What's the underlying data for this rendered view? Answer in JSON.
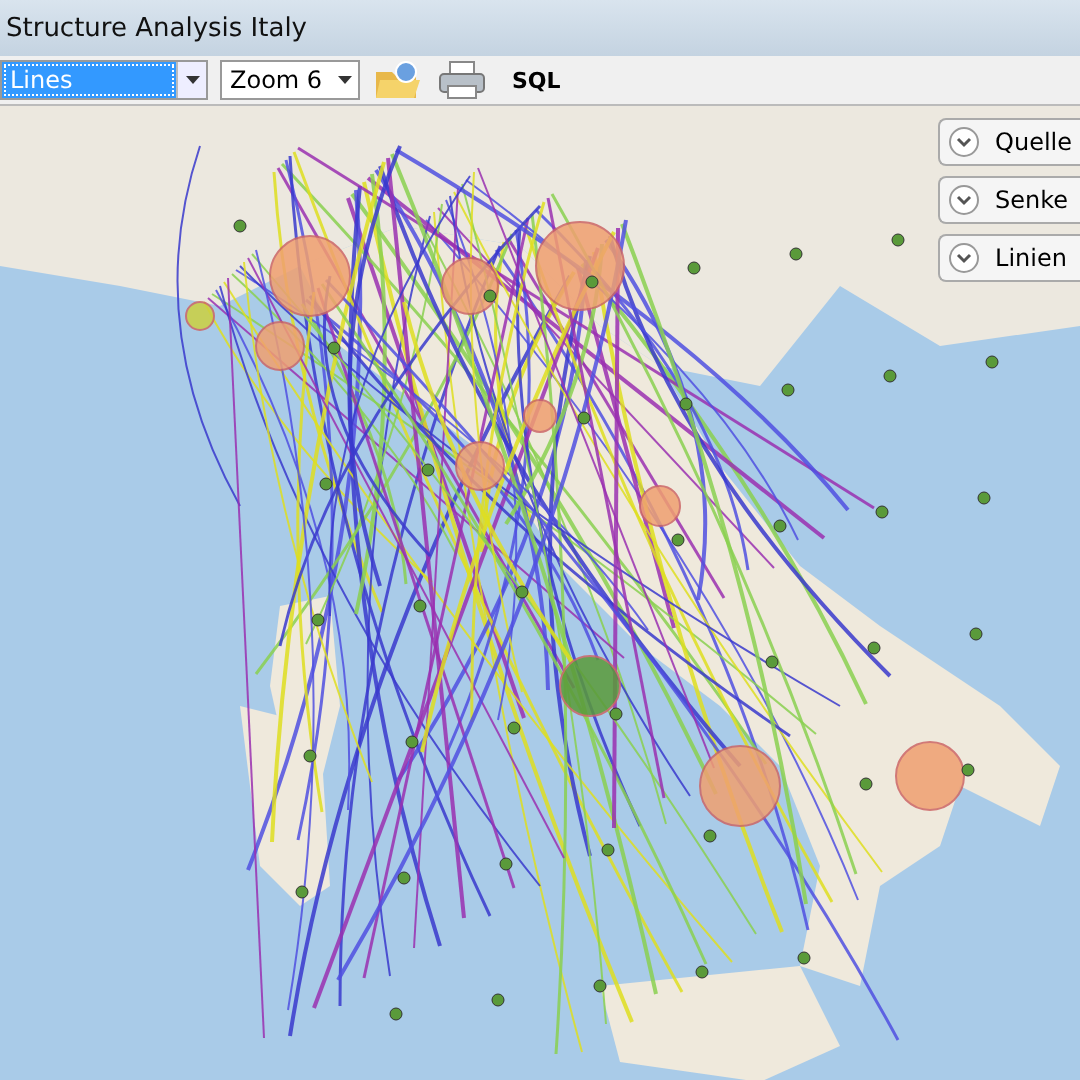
{
  "window": {
    "title": "Structure Analysis Italy"
  },
  "toolbar": {
    "layer_dropdown": {
      "value": "Lines",
      "focused": true
    },
    "zoom_dropdown": {
      "value": "Zoom 6"
    },
    "sql_button": {
      "label": "SQL"
    }
  },
  "map_panels": [
    {
      "label": "Quelle"
    },
    {
      "label": "Senke"
    },
    {
      "label": "Linien"
    }
  ]
}
